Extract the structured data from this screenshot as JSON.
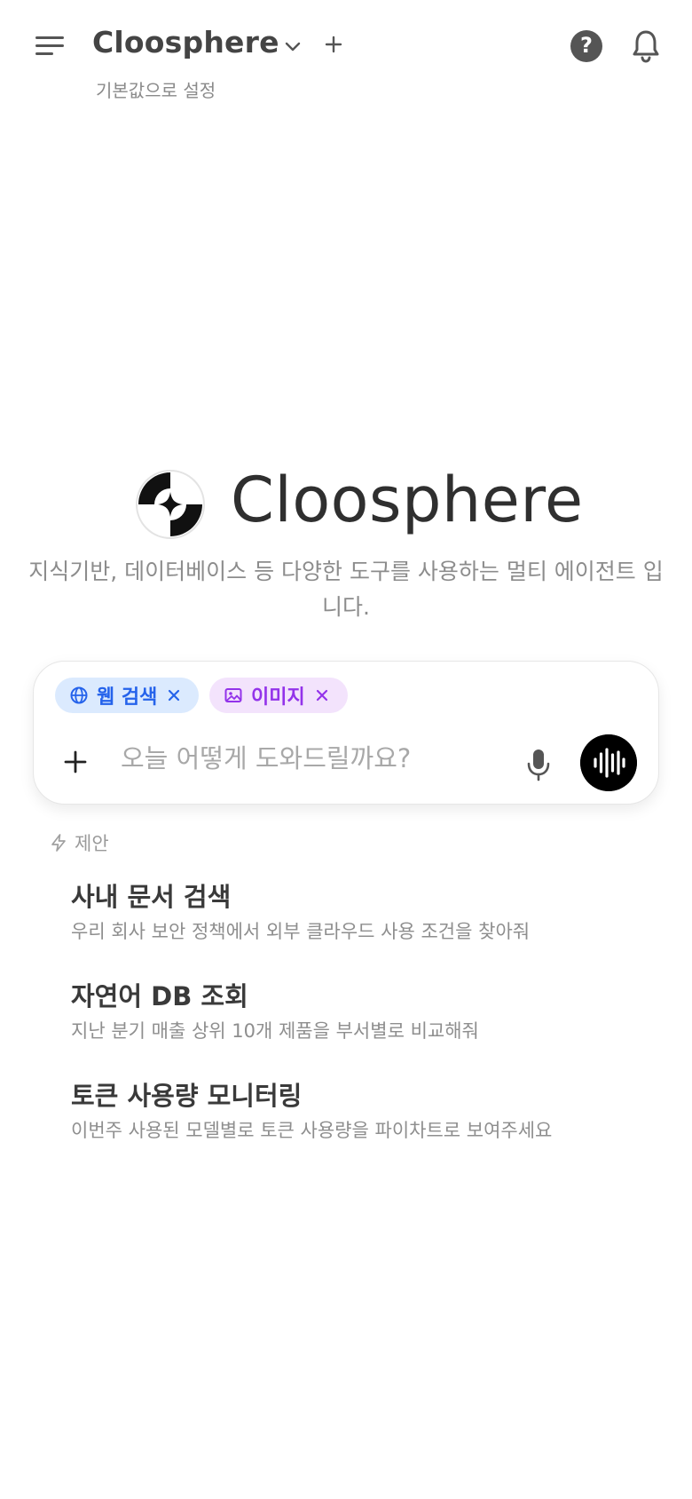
{
  "header": {
    "model_name": "Cloosphere",
    "set_default_label": "기본값으로 설정",
    "help_glyph": "?"
  },
  "hero": {
    "title": "Cloosphere",
    "subtitle": "지식기반, 데이터베이스 등 다양한 도구를 사용하는 멀티 에이전트 입니다."
  },
  "input": {
    "placeholder": "오늘 어떻게 도와드릴까요?",
    "value": "",
    "chips": [
      {
        "label": "웹 검색",
        "icon": "globe-icon",
        "color": "#2563eb",
        "bg": "#dbeafe"
      },
      {
        "label": "이미지",
        "icon": "image-icon",
        "color": "#9333ea",
        "bg": "#f3e3fc"
      }
    ]
  },
  "suggestions": {
    "heading": "제안",
    "items": [
      {
        "title": "사내 문서 검색",
        "description": "우리 회사 보안 정책에서 외부 클라우드 사용 조건을 찾아줘"
      },
      {
        "title": "자연어 DB 조회",
        "description": "지난 분기 매출 상위 10개 제품을 부서별로 비교해줘"
      },
      {
        "title": "토큰 사용량 모니터링",
        "description": "이번주 사용된 모델별로 토큰 사용량을 파이차트로 보여주세요"
      }
    ]
  }
}
